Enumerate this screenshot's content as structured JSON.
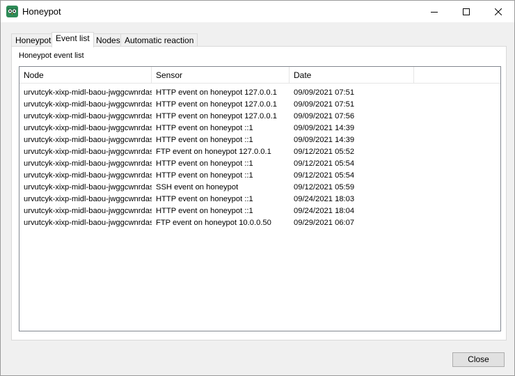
{
  "window": {
    "title": "Honeypot"
  },
  "tabs": [
    {
      "label": "Honeypot",
      "active": false
    },
    {
      "label": "Event list",
      "active": true
    },
    {
      "label": "Nodes",
      "active": false
    },
    {
      "label": "Automatic reaction",
      "active": false
    }
  ],
  "group": {
    "label": "Honeypot event list"
  },
  "table": {
    "columns": [
      "Node",
      "Sensor",
      "Date"
    ],
    "rows": [
      [
        "urvutcyk-xixp-midl-baou-jwggcwnrdasf",
        "HTTP event on honeypot 127.0.0.1",
        "09/09/2021 07:51"
      ],
      [
        "urvutcyk-xixp-midl-baou-jwggcwnrdasf",
        "HTTP event on honeypot 127.0.0.1",
        "09/09/2021 07:51"
      ],
      [
        "urvutcyk-xixp-midl-baou-jwggcwnrdasf",
        "HTTP event on honeypot 127.0.0.1",
        "09/09/2021 07:56"
      ],
      [
        "urvutcyk-xixp-midl-baou-jwggcwnrdasf",
        "HTTP event on honeypot ::1",
        "09/09/2021 14:39"
      ],
      [
        "urvutcyk-xixp-midl-baou-jwggcwnrdasf",
        "HTTP event on honeypot ::1",
        "09/09/2021 14:39"
      ],
      [
        "urvutcyk-xixp-midl-baou-jwggcwnrdasf",
        "FTP event on honeypot 127.0.0.1",
        "09/12/2021 05:52"
      ],
      [
        "urvutcyk-xixp-midl-baou-jwggcwnrdasf",
        "HTTP event on honeypot ::1",
        "09/12/2021 05:54"
      ],
      [
        "urvutcyk-xixp-midl-baou-jwggcwnrdasf",
        "HTTP event on honeypot ::1",
        "09/12/2021 05:54"
      ],
      [
        "urvutcyk-xixp-midl-baou-jwggcwnrdasf",
        "SSH event on honeypot",
        "09/12/2021 05:59"
      ],
      [
        "urvutcyk-xixp-midl-baou-jwggcwnrdasf",
        "HTTP event on honeypot ::1",
        "09/24/2021 18:03"
      ],
      [
        "urvutcyk-xixp-midl-baou-jwggcwnrdasf",
        "HTTP event on honeypot ::1",
        "09/24/2021 18:04"
      ],
      [
        "urvutcyk-xixp-midl-baou-jwggcwnrdasf",
        "FTP event on honeypot 10.0.0.50",
        "09/29/2021 06:07"
      ]
    ]
  },
  "buttons": {
    "close": "Close"
  },
  "icons": {
    "app": "owl-icon",
    "minimize": "minimize-icon",
    "maximize": "maximize-icon",
    "close": "close-icon"
  },
  "colors": {
    "accent": "#2e8b57",
    "border": "#828790"
  }
}
